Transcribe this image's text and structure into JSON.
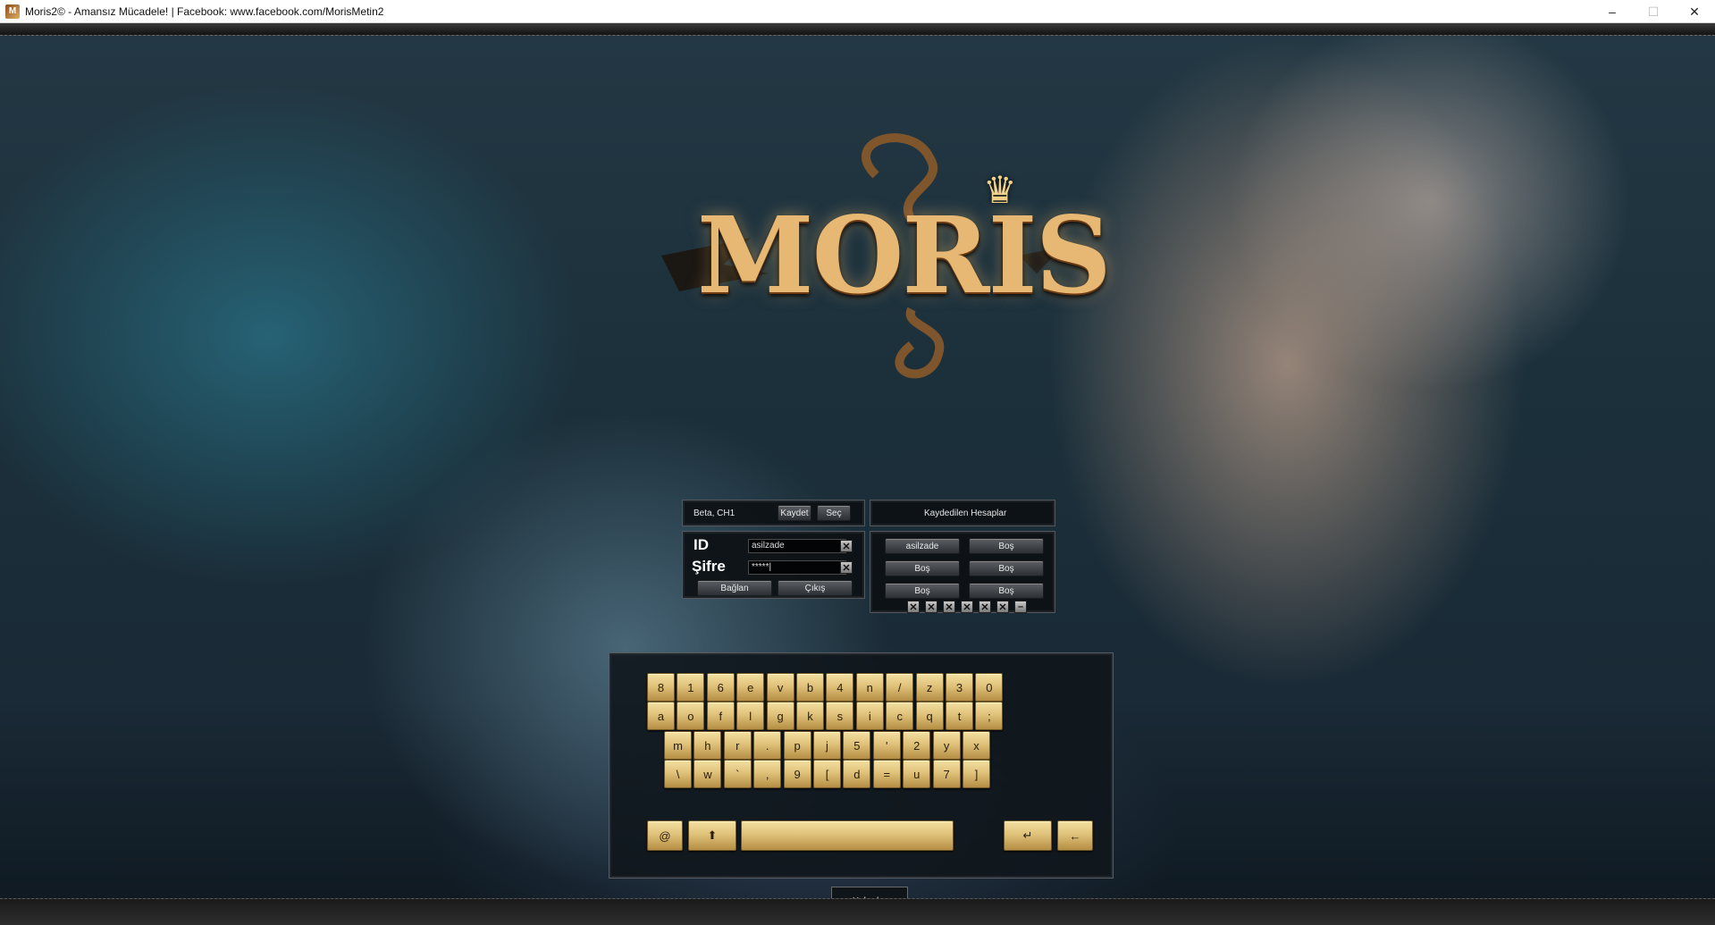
{
  "window": {
    "title": "Moris2© - Amansız Mücadele! | Facebook: www.facebook.com/MorisMetin2",
    "icon": "game-icon",
    "controls": {
      "minimize": "–",
      "maximize": "☐",
      "close": "✕"
    }
  },
  "logo": {
    "text": "MORIS",
    "crown": "♛"
  },
  "server_panel": {
    "server_label": "Beta, CH1",
    "save_button": "Kaydet",
    "select_button": "Seç"
  },
  "saved_header": {
    "title": "Kaydedilen Hesaplar"
  },
  "login": {
    "id_label": "ID",
    "password_label": "Şifre",
    "id_value": "asilzade",
    "password_value": "*****|",
    "clear_icon": "✕",
    "connect_button": "Bağlan",
    "exit_button": "Çıkış"
  },
  "saved_accounts": {
    "slots": [
      "asilzade",
      "Boş",
      "Boş",
      "Boş",
      "Boş",
      "Boş"
    ],
    "delete_icon": "✕",
    "minimize_icon": "–"
  },
  "keyboard": {
    "rows": [
      [
        "8",
        "1",
        "6",
        "e",
        "v",
        "b",
        "4",
        "n",
        "/",
        "z",
        "3",
        "0"
      ],
      [
        "a",
        "o",
        "f",
        "l",
        "g",
        "k",
        "s",
        "i",
        "c",
        "q",
        "t",
        ";"
      ],
      [
        "m",
        "h",
        "r",
        ".",
        "p",
        "j",
        "5",
        "'",
        "2",
        "y",
        "x"
      ],
      [
        "\\",
        "w",
        "`",
        ",",
        "9",
        "[",
        "d",
        "=",
        "u",
        "7",
        "]"
      ]
    ],
    "at_key": "@",
    "shift_key": "⬆",
    "enter_key": "↵",
    "backspace_key": "←"
  },
  "news": {
    "label": "Haberler"
  },
  "colors": {
    "key_gold": "#e0c27a",
    "panel_bg": "#0c1014",
    "logo_gold": "#e6b874"
  }
}
